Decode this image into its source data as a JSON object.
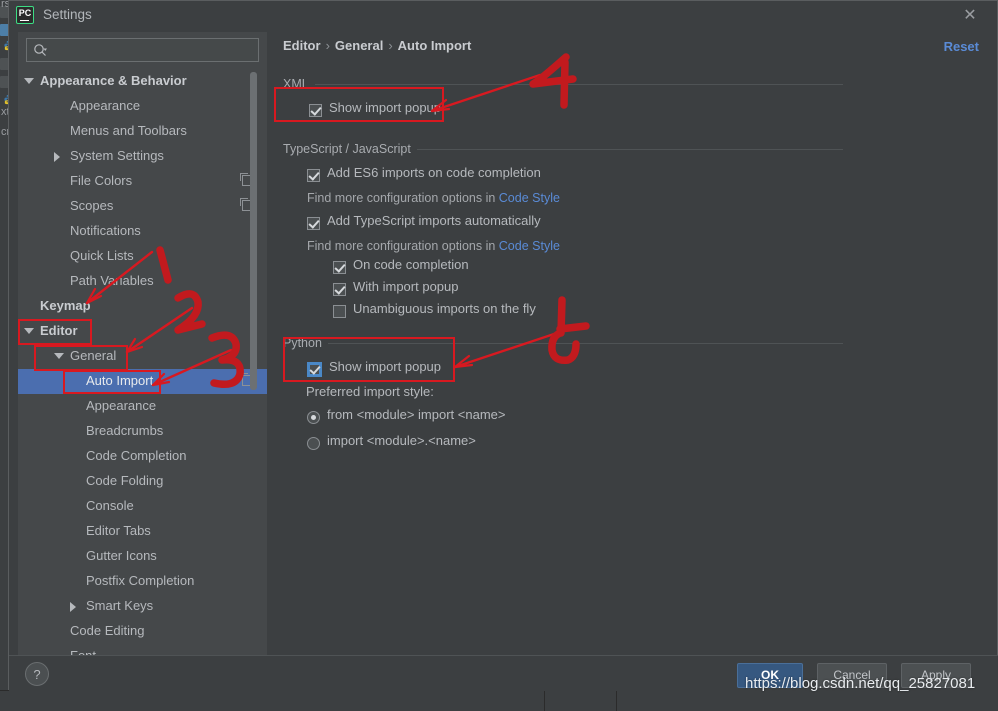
{
  "window": {
    "title": "Settings",
    "logo_label": "PC",
    "close_icon": "close-icon"
  },
  "search": {
    "value": "",
    "placeholder": ""
  },
  "sidebar": {
    "items": [
      {
        "label": "Appearance & Behavior",
        "indent": 22,
        "arrow": "down",
        "bold": true,
        "badge": false,
        "selected": false
      },
      {
        "label": "Appearance",
        "indent": 52,
        "arrow": "none",
        "bold": false,
        "badge": false,
        "selected": false
      },
      {
        "label": "Menus and Toolbars",
        "indent": 52,
        "arrow": "none",
        "bold": false,
        "badge": false,
        "selected": false
      },
      {
        "label": "System Settings",
        "indent": 52,
        "arrow": "right",
        "bold": false,
        "badge": false,
        "selected": false
      },
      {
        "label": "File Colors",
        "indent": 52,
        "arrow": "none",
        "bold": false,
        "badge": true,
        "selected": false
      },
      {
        "label": "Scopes",
        "indent": 52,
        "arrow": "none",
        "bold": false,
        "badge": true,
        "selected": false
      },
      {
        "label": "Notifications",
        "indent": 52,
        "arrow": "none",
        "bold": false,
        "badge": false,
        "selected": false
      },
      {
        "label": "Quick Lists",
        "indent": 52,
        "arrow": "none",
        "bold": false,
        "badge": false,
        "selected": false
      },
      {
        "label": "Path Variables",
        "indent": 52,
        "arrow": "none",
        "bold": false,
        "badge": false,
        "selected": false
      },
      {
        "label": "Keymap",
        "indent": 22,
        "arrow": "none",
        "bold": true,
        "badge": false,
        "selected": false
      },
      {
        "label": "Editor",
        "indent": 22,
        "arrow": "down",
        "bold": true,
        "badge": false,
        "selected": false
      },
      {
        "label": "General",
        "indent": 52,
        "arrow": "down",
        "bold": false,
        "badge": false,
        "selected": false
      },
      {
        "label": "Auto Import",
        "indent": 68,
        "arrow": "none",
        "bold": false,
        "badge": true,
        "selected": true
      },
      {
        "label": "Appearance",
        "indent": 68,
        "arrow": "none",
        "bold": false,
        "badge": false,
        "selected": false
      },
      {
        "label": "Breadcrumbs",
        "indent": 68,
        "arrow": "none",
        "bold": false,
        "badge": false,
        "selected": false
      },
      {
        "label": "Code Completion",
        "indent": 68,
        "arrow": "none",
        "bold": false,
        "badge": false,
        "selected": false
      },
      {
        "label": "Code Folding",
        "indent": 68,
        "arrow": "none",
        "bold": false,
        "badge": false,
        "selected": false
      },
      {
        "label": "Console",
        "indent": 68,
        "arrow": "none",
        "bold": false,
        "badge": false,
        "selected": false
      },
      {
        "label": "Editor Tabs",
        "indent": 68,
        "arrow": "none",
        "bold": false,
        "badge": false,
        "selected": false
      },
      {
        "label": "Gutter Icons",
        "indent": 68,
        "arrow": "none",
        "bold": false,
        "badge": false,
        "selected": false
      },
      {
        "label": "Postfix Completion",
        "indent": 68,
        "arrow": "none",
        "bold": false,
        "badge": false,
        "selected": false
      },
      {
        "label": "Smart Keys",
        "indent": 68,
        "arrow": "right",
        "bold": false,
        "badge": false,
        "selected": false
      },
      {
        "label": "Code Editing",
        "indent": 52,
        "arrow": "none",
        "bold": false,
        "badge": false,
        "selected": false
      },
      {
        "label": "Font",
        "indent": 52,
        "arrow": "none",
        "bold": false,
        "badge": false,
        "selected": false
      }
    ]
  },
  "content": {
    "breadcrumb": {
      "root": "Editor",
      "mid": "General",
      "leaf": "Auto Import",
      "separator": "›"
    },
    "reset_label": "Reset",
    "xml": {
      "section_label": "XML",
      "show_import_popup": "Show import popup"
    },
    "typescript": {
      "section_label": "TypeScript / JavaScript",
      "add_es6_imports": "Add ES6 imports on code completion",
      "hint1_prefix": "Find more configuration options in ",
      "hint1_link": "Code Style",
      "add_ts_imports": "Add TypeScript imports automatically",
      "hint2_prefix": "Find more configuration options in ",
      "hint2_link": "Code Style",
      "on_code_completion": "On code completion",
      "with_import_popup": "With import popup",
      "unambiguous_imports": "Unambiguous imports on the fly"
    },
    "python": {
      "section_label": "Python",
      "show_import_popup": "Show import popup",
      "preferred_style_label": "Preferred import style:",
      "radio_from": "from <module> import <name>",
      "radio_import": "import <module>.<name>"
    }
  },
  "footer": {
    "help_label": "?",
    "ok_label": "OK",
    "cancel_label": "Cancel",
    "apply_label": "Apply"
  },
  "annotations": {
    "marks": [
      "1",
      "2",
      "3",
      "4",
      "5"
    ],
    "color": "#d81920",
    "watermark": "https://blog.csdn.net/qq_25827081"
  },
  "ide_background": {
    "texts": [
      "rs",
      "xt",
      "cr"
    ]
  },
  "theme": {
    "accent_selection": "#4b6eaf",
    "link": "#5a8bd6",
    "panel": "#3c3f41",
    "tree_panel": "#45484a",
    "annotation_red": "#d81920"
  }
}
